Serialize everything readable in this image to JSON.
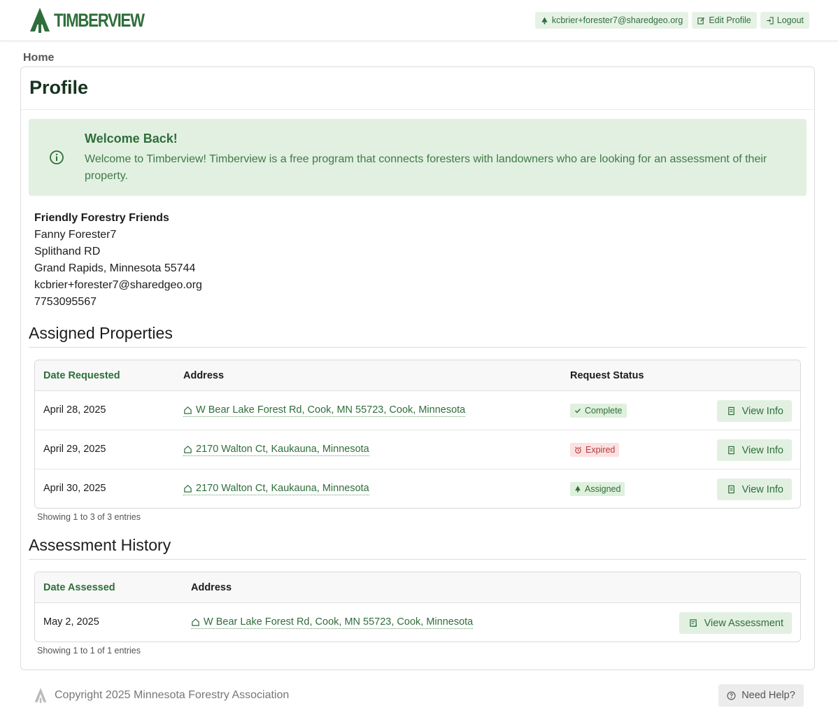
{
  "header": {
    "logo_text": "TIMBERVIEW",
    "user_email": "kcbrier+forester7@sharedgeo.org",
    "edit_profile": "Edit Profile",
    "logout": "Logout"
  },
  "breadcrumb": "Home",
  "page_title": "Profile",
  "alert": {
    "title": "Welcome Back!",
    "body": "Welcome to Timberview! Timberview is a free program that connects foresters with landowners who are looking for an assessment of their property."
  },
  "contact": {
    "organization": "Friendly Forestry Friends",
    "name": "Fanny Forester7",
    "street": "Splithand RD",
    "city_state_zip": "Grand Rapids, Minnesota 55744",
    "email": "kcbrier+forester7@sharedgeo.org",
    "phone": "7753095567"
  },
  "assigned": {
    "title": "Assigned Properties",
    "headers": {
      "date": "Date Requested",
      "address": "Address",
      "status": "Request Status"
    },
    "rows": [
      {
        "date": "April 28, 2025",
        "address": "W Bear Lake Forest Rd, Cook, MN 55723, Cook, Minnesota",
        "status": "Complete",
        "action": "View Info"
      },
      {
        "date": "April 29, 2025",
        "address": "2170 Walton Ct, Kaukauna, Minnesota",
        "status": "Expired",
        "action": "View Info"
      },
      {
        "date": "April 30, 2025",
        "address": "2170 Walton Ct, Kaukauna, Minnesota",
        "status": "Assigned",
        "action": "View Info"
      }
    ],
    "showing": "Showing 1 to 3 of 3 entries"
  },
  "history": {
    "title": "Assessment History",
    "headers": {
      "date": "Date Assessed",
      "address": "Address"
    },
    "rows": [
      {
        "date": "May 2, 2025",
        "address": "W Bear Lake Forest Rd, Cook, MN 55723, Cook, Minnesota",
        "action": "View Assessment"
      }
    ],
    "showing": "Showing 1 to 1 of 1 entries"
  },
  "footer": {
    "copyright": "Copyright 2025 Minnesota Forestry Association",
    "help": "Need Help?"
  },
  "colors": {
    "brand_green": "#2f6e3b",
    "alert_bg": "#e2f0e1",
    "expired_red": "#b23b3b"
  }
}
